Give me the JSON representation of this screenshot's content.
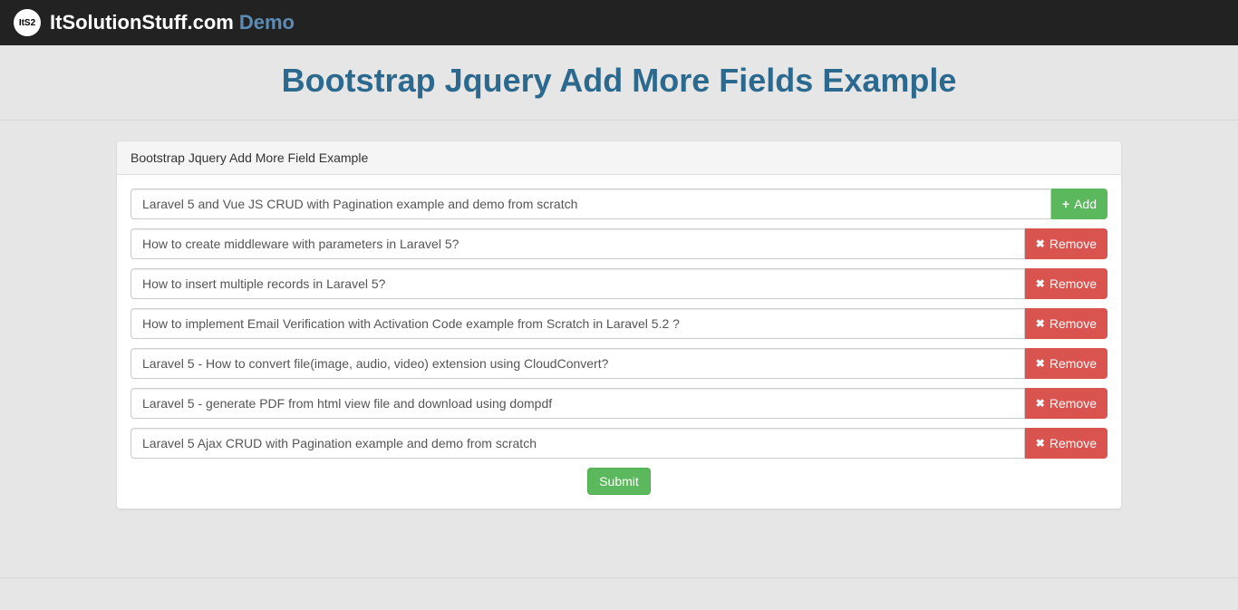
{
  "navbar": {
    "logo_text": "ItS2",
    "brand": "ItSolutionStuff.com",
    "demo": "Demo"
  },
  "page_title": "Bootstrap Jquery Add More Fields Example",
  "panel": {
    "heading": "Bootstrap Jquery Add More Field Example",
    "add_label": "Add",
    "remove_label": "Remove",
    "submit_label": "Submit",
    "fields": [
      {
        "value": "Laravel 5 and Vue JS CRUD with Pagination example and demo from scratch",
        "action": "add"
      },
      {
        "value": "How to create middleware with parameters in Laravel 5?",
        "action": "remove"
      },
      {
        "value": "How to insert multiple records in Laravel 5?",
        "action": "remove"
      },
      {
        "value": "How to implement Email Verification with Activation Code example from Scratch in Laravel 5.2 ?",
        "action": "remove"
      },
      {
        "value": "Laravel 5 - How to convert file(image, audio, video) extension using CloudConvert?",
        "action": "remove"
      },
      {
        "value": "Laravel 5 - generate PDF from html view file and download using dompdf",
        "action": "remove"
      },
      {
        "value": "Laravel 5 Ajax CRUD with Pagination example and demo from scratch",
        "action": "remove"
      }
    ]
  }
}
